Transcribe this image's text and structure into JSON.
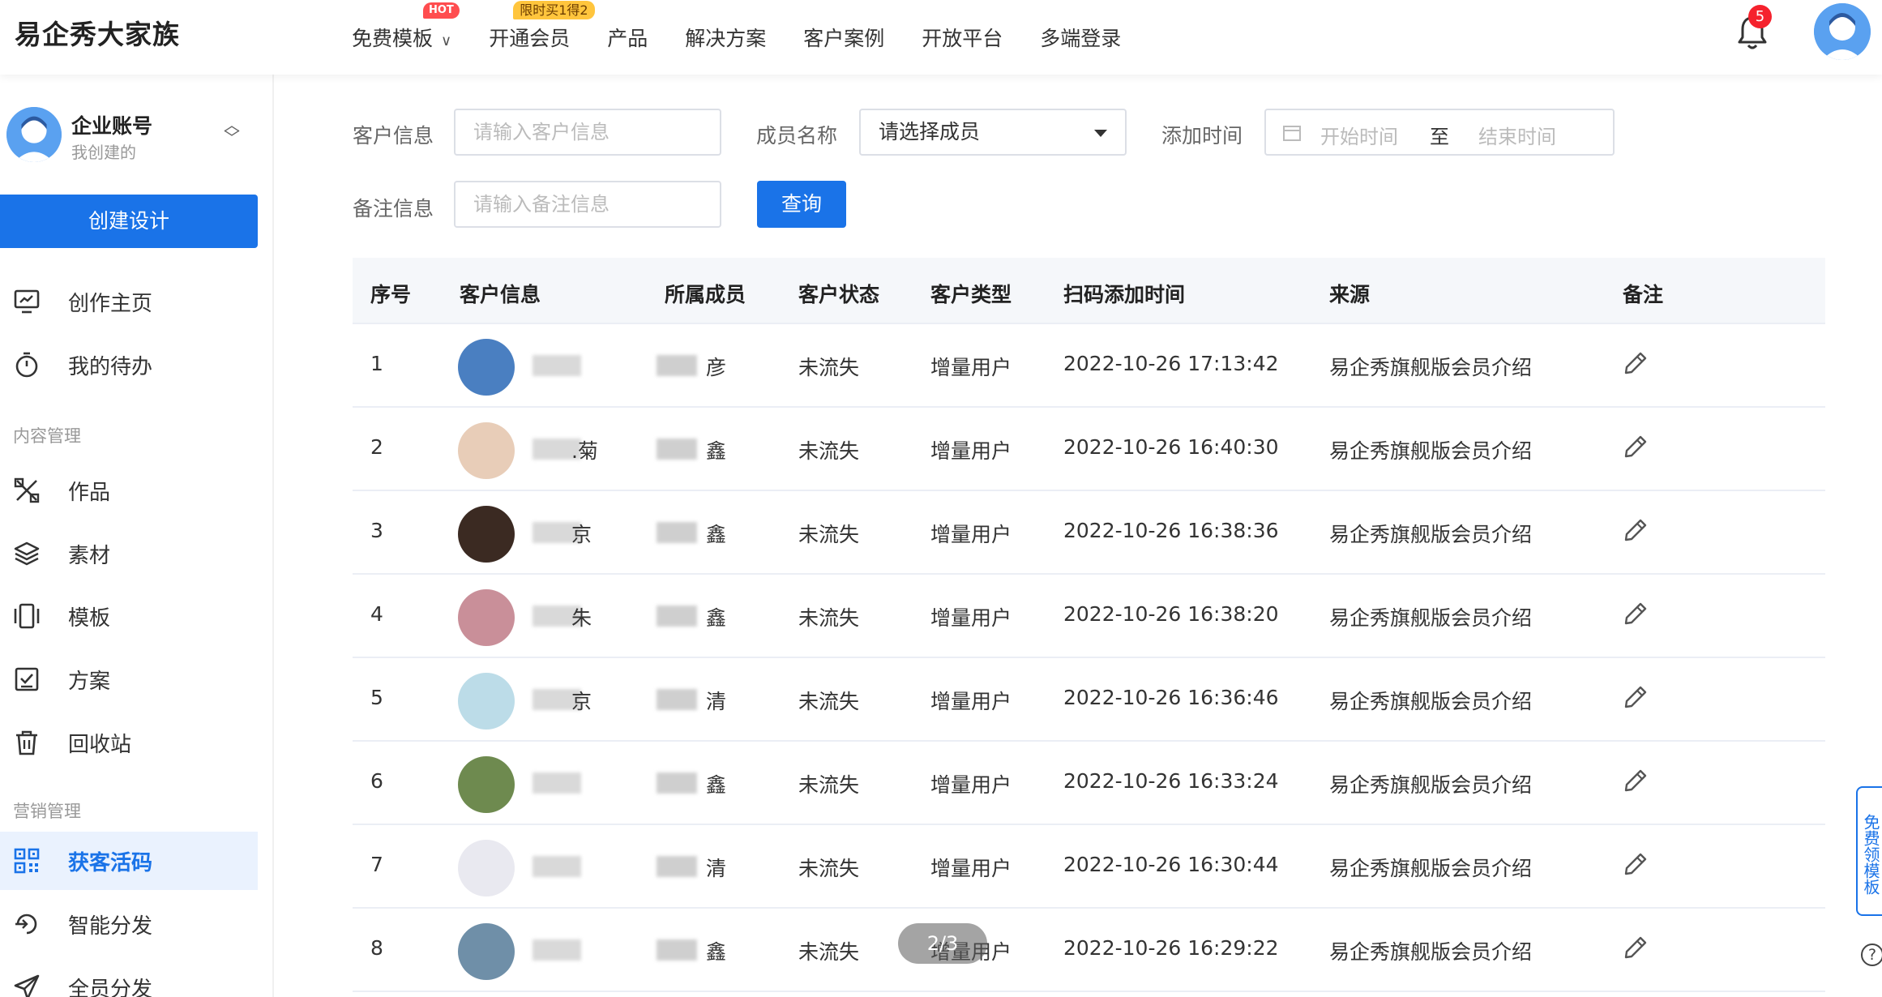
{
  "brand": "易企秀大家族",
  "topnav": [
    {
      "label": "免费模板",
      "badge": "HOT",
      "has_dropdown": true
    },
    {
      "label": "开通会员",
      "badge": "限时买1得2"
    },
    {
      "label": "产品"
    },
    {
      "label": "解决方案"
    },
    {
      "label": "客户案例"
    },
    {
      "label": "开放平台"
    },
    {
      "label": "多端登录"
    }
  ],
  "notifications": {
    "count": "5"
  },
  "account": {
    "name": "企业账号",
    "sub": "我创建的"
  },
  "create_button": "创建设计",
  "sidebar": {
    "top_items": [
      {
        "label": "创作主页",
        "icon": "monitor-icon"
      },
      {
        "label": "我的待办",
        "icon": "stopwatch-icon"
      }
    ],
    "section_content": "内容管理",
    "content_items": [
      {
        "label": "作品",
        "icon": "tools-icon"
      },
      {
        "label": "素材",
        "icon": "layers-icon"
      },
      {
        "label": "模板",
        "icon": "template-icon"
      },
      {
        "label": "方案",
        "icon": "checklist-icon"
      },
      {
        "label": "回收站",
        "icon": "trash-icon"
      }
    ],
    "section_marketing": "营销管理",
    "marketing_items": [
      {
        "label": "获客活码",
        "icon": "qrcode-icon",
        "active": true
      },
      {
        "label": "智能分发",
        "icon": "distribute-icon"
      },
      {
        "label": "全员分发",
        "icon": "send-icon"
      }
    ]
  },
  "filters": {
    "customer_label": "客户信息",
    "customer_placeholder": "请输入客户信息",
    "member_label": "成员名称",
    "member_value": "请选择成员",
    "time_label": "添加时间",
    "start_placeholder": "开始时间",
    "range_separator": "至",
    "end_placeholder": "结束时间",
    "remark_label": "备注信息",
    "remark_placeholder": "请输入备注信息",
    "query_button": "查询"
  },
  "table": {
    "columns": [
      "序号",
      "客户信息",
      "所属成员",
      "客户状态",
      "客户类型",
      "扫码添加时间",
      "来源",
      "备注"
    ],
    "rows": [
      {
        "num": "1",
        "name_frag": "",
        "member_frag": "彦",
        "status": "未流失",
        "type": "增量用户",
        "time": "2022-10-26 17:13:42",
        "source": "易企秀旗舰版会员介绍",
        "avatar_color": "#4a7fc1"
      },
      {
        "num": "2",
        "name_frag": ".菊",
        "member_frag": "鑫",
        "status": "未流失",
        "type": "增量用户",
        "time": "2022-10-26 16:40:30",
        "source": "易企秀旗舰版会员介绍",
        "avatar_color": "#e8cdb8"
      },
      {
        "num": "3",
        "name_frag": "京",
        "member_frag": "鑫",
        "status": "未流失",
        "type": "增量用户",
        "time": "2022-10-26 16:38:36",
        "source": "易企秀旗舰版会员介绍",
        "avatar_color": "#3b2a22"
      },
      {
        "num": "4",
        "name_frag": "朱",
        "member_frag": "鑫",
        "status": "未流失",
        "type": "增量用户",
        "time": "2022-10-26 16:38:20",
        "source": "易企秀旗舰版会员介绍",
        "avatar_color": "#c98f99"
      },
      {
        "num": "5",
        "name_frag": "京",
        "member_frag": "清",
        "status": "未流失",
        "type": "增量用户",
        "time": "2022-10-26 16:36:46",
        "source": "易企秀旗舰版会员介绍",
        "avatar_color": "#bcdce8"
      },
      {
        "num": "6",
        "name_frag": "",
        "member_frag": "鑫",
        "status": "未流失",
        "type": "增量用户",
        "time": "2022-10-26 16:33:24",
        "source": "易企秀旗舰版会员介绍",
        "avatar_color": "#6e8a4f"
      },
      {
        "num": "7",
        "name_frag": "",
        "member_frag": "清",
        "status": "未流失",
        "type": "增量用户",
        "time": "2022-10-26 16:30:44",
        "source": "易企秀旗舰版会员介绍",
        "avatar_color": "#e9e9f0"
      },
      {
        "num": "8",
        "name_frag": "",
        "member_frag": "鑫",
        "status": "未流失",
        "type": "增量用户",
        "time": "2022-10-26 16:29:22",
        "source": "易企秀旗舰版会员介绍",
        "avatar_color": "#6f8fa8"
      }
    ]
  },
  "pager": "2/3",
  "side_tab": "免费领模板",
  "help": "?",
  "colors": {
    "primary": "#1a73e8",
    "hot": "#ff4d4f",
    "promo": "#ffc53d"
  }
}
